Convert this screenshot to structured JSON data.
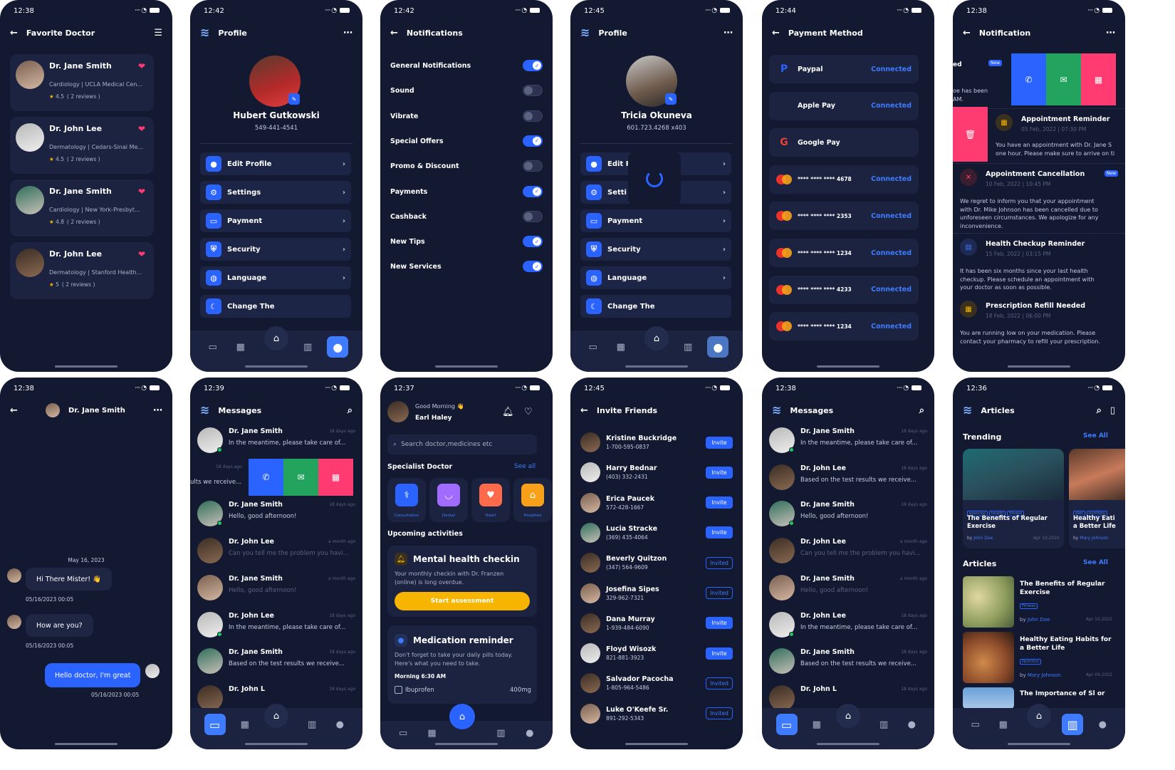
{
  "p1": {
    "time": "12:38",
    "title": "Favorite Doctor",
    "doctors": [
      {
        "name": "Dr. Jane Smith",
        "spec": "Cardiology | UCLA Medical Cen...",
        "rating": "4.5",
        "reviews": "( 2 reviews )"
      },
      {
        "name": "Dr. John Lee",
        "spec": "Dermatology | Cedars-Sinai Me...",
        "rating": "4.5",
        "reviews": "( 2 reviews )"
      },
      {
        "name": "Dr. Jane Smith",
        "spec": "Cardiology | New York-Presbyt...",
        "rating": "4.8",
        "reviews": "( 2 reviews )"
      },
      {
        "name": "Dr. John Lee",
        "spec": "Dermatology | Stanford Health...",
        "rating": "5",
        "reviews": "( 2 reviews )"
      }
    ]
  },
  "p2": {
    "time": "12:42",
    "title": "Profile",
    "name": "Hubert Gutkowski",
    "phone": "549-441-4541",
    "menu": [
      "Edit Profile",
      "Settings",
      "Payment",
      "Security",
      "Language",
      "Change The"
    ]
  },
  "p3": {
    "time": "12:42",
    "title": "Notifications",
    "items": [
      {
        "label": "General Notifications",
        "on": true
      },
      {
        "label": "Sound",
        "on": false
      },
      {
        "label": "Vibrate",
        "on": false
      },
      {
        "label": "Special Offers",
        "on": true
      },
      {
        "label": "Promo & Discount",
        "on": false
      },
      {
        "label": "Payments",
        "on": true
      },
      {
        "label": "Cashback",
        "on": false
      },
      {
        "label": "New Tips",
        "on": true
      },
      {
        "label": "New Services",
        "on": true
      }
    ]
  },
  "p4": {
    "time": "12:45",
    "title": "Profile",
    "name": "Tricia Okuneva",
    "phone": "601.723.4268 x403",
    "menu": [
      "Edit P",
      "Setti",
      "Payment",
      "Security",
      "Language",
      "Change The"
    ]
  },
  "p5": {
    "time": "12:44",
    "title": "Payment Method",
    "methods": [
      {
        "label": "Paypal",
        "status": "Connected",
        "icon": "paypal"
      },
      {
        "label": "Apple Pay",
        "status": "Connected",
        "icon": "apple"
      },
      {
        "label": "Google Pay",
        "status": "",
        "icon": "google"
      },
      {
        "label": "**** **** **** 4678",
        "status": "Connected",
        "icon": "mastercard"
      },
      {
        "label": "**** **** **** 2353",
        "status": "Connected",
        "icon": "mastercard"
      },
      {
        "label": "**** **** **** 1234",
        "status": "Connected",
        "icon": "mastercard"
      },
      {
        "label": "**** **** **** 4233",
        "status": "Connected",
        "icon": "mastercard"
      },
      {
        "label": "**** **** **** 1234",
        "status": "Connected",
        "icon": "mastercard"
      }
    ]
  },
  "p6": {
    "time": "12:38",
    "title": "Notification",
    "partial1": "ed",
    "partial2": "oe has been\nAM.",
    "new": "New",
    "items": [
      {
        "title": "Appointment Reminder",
        "date": "05 Feb, 2022 | 07:30 PM",
        "body": "You have an appointment with Dr. Jane S\none hour. Please make sure to arrive on ti"
      },
      {
        "title": "Appointment Cancellation",
        "date": "10 Feb, 2022 | 10:45 PM",
        "body": "We regret to inform you that your appointment with Dr. Mike Johnson has been cancelled due to unforeseen circumstances. We apologize for any inconvenience.",
        "badge": "New"
      },
      {
        "title": "Health Checkup Reminder",
        "date": "15 Feb, 2022 | 03:15 PM",
        "body": "It has been six months since your last health checkup. Please schedule an appointment with your doctor as soon as possible."
      },
      {
        "title": "Prescription Refill Needed",
        "date": "18 Feb, 2022 | 06:00 PM",
        "body": "You are running low on your medication. Please contact your pharmacy to refill your prescription."
      }
    ]
  },
  "p7": {
    "time": "12:38",
    "name": "Dr. Jane Smith",
    "date": "May 16, 2023",
    "m1": "Hi There Mister! 👋",
    "t1": "05/16/2023  00:05",
    "m2": "How are you?",
    "t2": "05/16/2023  00:05",
    "m3": "Hello doctor, I'm great",
    "t3": "05/16/2023  00:05"
  },
  "p8": {
    "time": "12:39",
    "title": "Messages",
    "msgs": [
      {
        "name": "Dr. Jane Smith",
        "text": "In the meantime, please take care of...",
        "time": "18 days ago"
      },
      {
        "name": "",
        "text": "ults we receive...",
        "time": "18 days ago"
      },
      {
        "name": "Dr. Jane Smith",
        "text": "Hello, good afternoon!",
        "time": "18 days ago"
      },
      {
        "name": "Dr. John Lee",
        "text": "Can you tell me the problem you havi...",
        "time": "a month ago"
      },
      {
        "name": "Dr. Jane Smith",
        "text": "Hello, good afternoon!",
        "time": "a month ago"
      },
      {
        "name": "Dr. John Lee",
        "text": "In the meantime, please take care of...",
        "time": "18 days ago"
      },
      {
        "name": "Dr. Jane Smith",
        "text": "Based on the test results we receive...",
        "time": "18 days ago"
      },
      {
        "name": "Dr. John L",
        "text": "",
        "time": "18 days ago"
      }
    ]
  },
  "p9": {
    "time": "12:37",
    "greet": "Good Morning 👋",
    "name": "Earl Haley",
    "search": "Search doctor,medicines etc",
    "spec": "Specialist Doctor",
    "seeall": "See all",
    "cats": [
      "Consultation",
      "Dental",
      "Heart",
      "Hospitals"
    ],
    "upcoming": "Upcoming activities",
    "c1": {
      "title": "Mental health checkin",
      "body": "Your monthly checkin with Dr. Franzen (online) is long overdue.",
      "btn": "Start assessment"
    },
    "c2": {
      "title": "Medication reminder",
      "body": "Don't forget to take your daily pills today. Here's what you need to take.",
      "time": "Morning 6:30 AM",
      "med": "Ibuprofen",
      "dose": "400mg"
    }
  },
  "p10": {
    "time": "12:45",
    "title": "Invite Friends",
    "friends": [
      {
        "name": "Kristine Buckridge",
        "phone": "1-700-595-0837",
        "st": "Invite"
      },
      {
        "name": "Harry Bednar",
        "phone": "(403) 332-2431",
        "st": "Invite"
      },
      {
        "name": "Erica Paucek",
        "phone": "572-428-1667",
        "st": "Invite"
      },
      {
        "name": "Lucia Stracke",
        "phone": "(369) 435-4064",
        "st": "Invite"
      },
      {
        "name": "Beverly Quitzon",
        "phone": "(347) 564-9609",
        "st": "Invited"
      },
      {
        "name": "Josefina Sipes",
        "phone": "329-962-7321",
        "st": "Invited"
      },
      {
        "name": "Dana Murray",
        "phone": "1-939-484-6090",
        "st": "Invite"
      },
      {
        "name": "Floyd Wisozk",
        "phone": "821-881-3923",
        "st": "Invite"
      },
      {
        "name": "Salvador Pacocha",
        "phone": "1-805-964-5486",
        "st": "Invited"
      },
      {
        "name": "Luke O'Keefe Sr.",
        "phone": "891-292-5343",
        "st": "Invited"
      }
    ]
  },
  "p11": {
    "time": "12:38",
    "title": "Messages",
    "msgs": [
      {
        "name": "Dr. Jane Smith",
        "text": "In the meantime, please take care of...",
        "time": "18 days ago"
      },
      {
        "name": "Dr. John Lee",
        "text": "Based on the test results we receive...",
        "time": "18 days ago"
      },
      {
        "name": "Dr. Jane Smith",
        "text": "Hello, good afternoon!",
        "time": "18 days ago"
      },
      {
        "name": "Dr. John Lee",
        "text": "Can you tell me the problem you havi...",
        "time": "a month ago"
      },
      {
        "name": "Dr. Jane Smith",
        "text": "Hello, good afternoon!",
        "time": "a month ago"
      },
      {
        "name": "Dr. John Lee",
        "text": "In the meantime, please take care of...",
        "time": "18 days ago"
      },
      {
        "name": "Dr. Jane Smith",
        "text": "Based on the test results we receive...",
        "time": "18 days ago"
      },
      {
        "name": "Dr. John L",
        "text": "",
        "time": "18 days ago"
      }
    ]
  },
  "p12": {
    "time": "12:36",
    "title": "Articles",
    "trending": "Trending",
    "seeall": "See All",
    "articles": "Articles",
    "t1": {
      "title": "The Benefits of Regular Exercise",
      "by": "by",
      "author": "John Doe",
      "date": "Apr 10,2022",
      "tags": [
        "exercise",
        "health",
        "fitness"
      ]
    },
    "t2": {
      "title": "Healthy Eati a Better Life",
      "by": "by",
      "author": "Mary Johnson",
      "tags": [
        "diet",
        "nutrition"
      ]
    },
    "a1": {
      "title": "The Benefits of Regular Exercise",
      "tag": "Fitness",
      "by": "by",
      "author": "John Doe",
      "date": "Apr 10,2022"
    },
    "a2": {
      "title": "Healthy Eating Habits for a Better Life",
      "tag": "Nutrition",
      "by": "by",
      "author": "Mary Johnson",
      "date": "Apr 09,2022"
    },
    "a3": {
      "title": "The Importance of Sl or"
    }
  }
}
